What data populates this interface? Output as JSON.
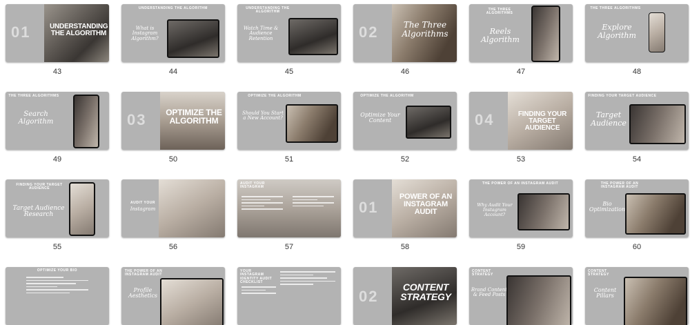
{
  "slides": [
    {
      "num": "43",
      "ghost": "01",
      "title": "UNDERSTANDING THE ALGORITHM"
    },
    {
      "num": "44",
      "caption": "UNDERSTANDING THE ALGORITHM",
      "script": "What is Instagram Algorithm?"
    },
    {
      "num": "45",
      "caption": "UNDERSTANDING THE ALGORITHM",
      "script": "Watch Time & Audience Retention"
    },
    {
      "num": "46",
      "ghost": "02",
      "script": "The Three Algorithms"
    },
    {
      "num": "47",
      "caption": "THE THREE ALGORITHMS",
      "script": "Reels Algorithm"
    },
    {
      "num": "48",
      "caption": "THE THREE ALGORITHMS",
      "script": "Explore Algorithm"
    },
    {
      "num": "49",
      "caption": "THE THREE ALGORITHMS",
      "script": "Search Algorithm"
    },
    {
      "num": "50",
      "ghost": "03",
      "title": "OPTIMIZE THE ALGORITHM"
    },
    {
      "num": "51",
      "caption": "OPTIMIZE THE ALGORITHM",
      "script": "Should You Start a New Account?"
    },
    {
      "num": "52",
      "caption": "OPTIMIZE THE ALGORITHM",
      "script": "Optimize Your Content"
    },
    {
      "num": "53",
      "ghost": "04",
      "title": "FINDING YOUR TARGET AUDIENCE"
    },
    {
      "num": "54",
      "caption": "FINDING YOUR TARGET AUDIENCE",
      "script": "Target Audience"
    },
    {
      "num": "55",
      "caption": "FINDING YOUR TARGET AUDIENCE",
      "script": "Target Audience Research"
    },
    {
      "num": "56",
      "caption": "AUDIT YOUR",
      "script": "Instagram"
    },
    {
      "num": "57",
      "caption": "AUDIT YOUR INSTAGRAM"
    },
    {
      "num": "58",
      "ghost": "01",
      "title": "POWER OF AN INSTAGRAM AUDIT"
    },
    {
      "num": "59",
      "caption": "THE POWER OF AN INSTAGRAM AUDIT",
      "script": "Why Audit Your Instagram Account?"
    },
    {
      "num": "60",
      "caption": "THE POWER OF AN INSTAGRAM AUDIT",
      "script": "Bio Optimization"
    },
    {
      "caption": "OPTIMIZE YOUR BIO"
    },
    {
      "caption": "THE POWER OF AN INSTAGRAM AUDIT",
      "script": "Profile Aesthetics"
    },
    {
      "caption": "YOUR INSTAGRAM IDENTITY AUDIT CHECKLIST"
    },
    {
      "ghost": "02",
      "title": "CONTENT STRATEGY"
    },
    {
      "caption": "CONTENT STRATEGY",
      "script": "Brand Content & Feed Posts"
    },
    {
      "caption": "CONTENT STRATEGY",
      "script": "Content Pillars"
    }
  ]
}
